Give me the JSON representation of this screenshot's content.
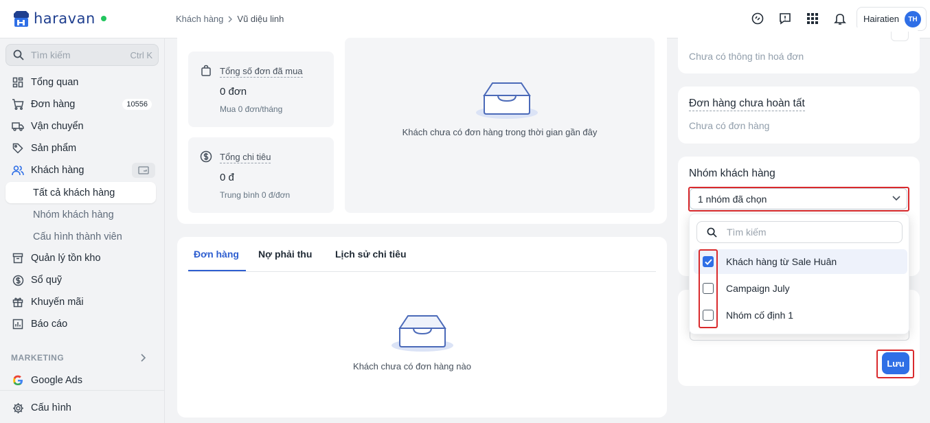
{
  "app": {
    "logo_text": "haravan"
  },
  "breadcrumb": {
    "parent": "Khách hàng",
    "current": "Vũ diệu linh"
  },
  "topbar": {
    "user_name": "Hairatien",
    "user_initials": "TH"
  },
  "sidebar": {
    "search_placeholder": "Tìm kiếm",
    "search_shortcut": "Ctrl K",
    "items": [
      {
        "label": "Tổng quan",
        "icon": "dashboard-icon"
      },
      {
        "label": "Đơn hàng",
        "icon": "cart-icon",
        "badge": "10556"
      },
      {
        "label": "Vận chuyển",
        "icon": "truck-icon"
      },
      {
        "label": "Sản phẩm",
        "icon": "tag-icon"
      },
      {
        "label": "Khách hàng",
        "icon": "users-icon"
      },
      {
        "label": "Quản lý tồn kho",
        "icon": "inventory-icon"
      },
      {
        "label": "Sổ quỹ",
        "icon": "dollar-icon"
      },
      {
        "label": "Khuyến mãi",
        "icon": "gift-icon"
      },
      {
        "label": "Báo cáo",
        "icon": "report-icon"
      }
    ],
    "sub_items": [
      "Tất cả khách hàng",
      "Nhóm khách hàng",
      "Cấu hình thành viên"
    ],
    "marketing_label": "MARKETING",
    "google_ads": "Google Ads",
    "settings": "Cấu hình"
  },
  "stats": {
    "orders": {
      "title": "Tổng số đơn đã mua",
      "value": "0 đơn",
      "sub": "Mua 0 đơn/tháng"
    },
    "spend": {
      "title": "Tổng chi tiêu",
      "value": "0 đ",
      "sub": "Trung bình 0 đ/đơn"
    },
    "recent_empty": "Khách chưa có đơn hàng trong thời gian gần đây"
  },
  "tabs": {
    "items": [
      "Đơn hàng",
      "Nợ phải thu",
      "Lịch sử chi tiêu"
    ],
    "empty": "Khách chưa có đơn hàng nào"
  },
  "right": {
    "invoice_empty": "Chưa có thông tin hoá đơn",
    "pending_title": "Đơn hàng chưa hoàn tất",
    "pending_empty": "Chưa có đơn hàng",
    "group_title": "Nhóm khách hàng",
    "group_select_value": "1 nhóm đã chọn",
    "dropdown_search_placeholder": "Tìm kiếm",
    "options": [
      {
        "label": "Khách hàng từ Sale Huân",
        "checked": true
      },
      {
        "label": "Campaign July",
        "checked": false
      },
      {
        "label": "Nhóm cố định 1",
        "checked": false
      }
    ],
    "save_label": "Lưu"
  },
  "colors": {
    "accent": "#2f6fe6",
    "highlight_border": "#d9292c",
    "logo": "#1f3f8f"
  }
}
